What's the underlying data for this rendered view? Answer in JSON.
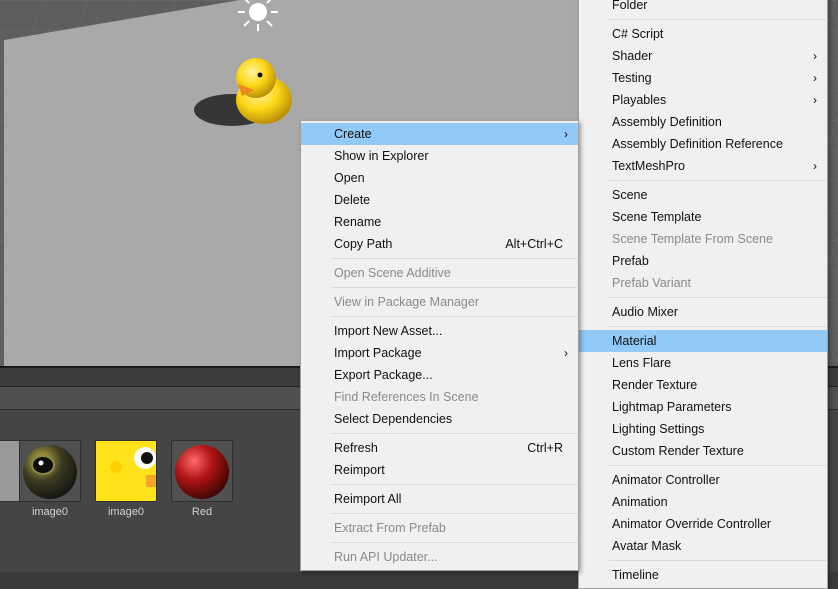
{
  "context_menu": {
    "items": [
      {
        "label": "Create",
        "shortcut": "",
        "submenu": true,
        "disabled": false,
        "highlighted": true
      },
      {
        "label": "Show in Explorer",
        "shortcut": "",
        "submenu": false,
        "disabled": false
      },
      {
        "label": "Open",
        "shortcut": "",
        "submenu": false,
        "disabled": false
      },
      {
        "label": "Delete",
        "shortcut": "",
        "submenu": false,
        "disabled": false
      },
      {
        "label": "Rename",
        "shortcut": "",
        "submenu": false,
        "disabled": false
      },
      {
        "label": "Copy Path",
        "shortcut": "Alt+Ctrl+C",
        "submenu": false,
        "disabled": false
      },
      {
        "sep": true
      },
      {
        "label": "Open Scene Additive",
        "shortcut": "",
        "submenu": false,
        "disabled": true
      },
      {
        "sep": true
      },
      {
        "label": "View in Package Manager",
        "shortcut": "",
        "submenu": false,
        "disabled": true
      },
      {
        "sep": true
      },
      {
        "label": "Import New Asset...",
        "shortcut": "",
        "submenu": false,
        "disabled": false
      },
      {
        "label": "Import Package",
        "shortcut": "",
        "submenu": true,
        "disabled": false
      },
      {
        "label": "Export Package...",
        "shortcut": "",
        "submenu": false,
        "disabled": false
      },
      {
        "label": "Find References In Scene",
        "shortcut": "",
        "submenu": false,
        "disabled": true
      },
      {
        "label": "Select Dependencies",
        "shortcut": "",
        "submenu": false,
        "disabled": false
      },
      {
        "sep": true
      },
      {
        "label": "Refresh",
        "shortcut": "Ctrl+R",
        "submenu": false,
        "disabled": false
      },
      {
        "label": "Reimport",
        "shortcut": "",
        "submenu": false,
        "disabled": false
      },
      {
        "sep": true
      },
      {
        "label": "Reimport All",
        "shortcut": "",
        "submenu": false,
        "disabled": false
      },
      {
        "sep": true
      },
      {
        "label": "Extract From Prefab",
        "shortcut": "",
        "submenu": false,
        "disabled": true
      },
      {
        "sep": true
      },
      {
        "label": "Run API Updater...",
        "shortcut": "",
        "submenu": false,
        "disabled": true
      }
    ]
  },
  "create_submenu": {
    "items": [
      {
        "label": "Folder",
        "submenu": false,
        "disabled": false
      },
      {
        "sep": true
      },
      {
        "label": "C# Script",
        "submenu": false,
        "disabled": false
      },
      {
        "label": "Shader",
        "submenu": true,
        "disabled": false
      },
      {
        "label": "Testing",
        "submenu": true,
        "disabled": false
      },
      {
        "label": "Playables",
        "submenu": true,
        "disabled": false
      },
      {
        "label": "Assembly Definition",
        "submenu": false,
        "disabled": false
      },
      {
        "label": "Assembly Definition Reference",
        "submenu": false,
        "disabled": false
      },
      {
        "label": "TextMeshPro",
        "submenu": true,
        "disabled": false
      },
      {
        "sep": true
      },
      {
        "label": "Scene",
        "submenu": false,
        "disabled": false
      },
      {
        "label": "Scene Template",
        "submenu": false,
        "disabled": false
      },
      {
        "label": "Scene Template From Scene",
        "submenu": false,
        "disabled": true
      },
      {
        "label": "Prefab",
        "submenu": false,
        "disabled": false
      },
      {
        "label": "Prefab Variant",
        "submenu": false,
        "disabled": true
      },
      {
        "sep": true
      },
      {
        "label": "Audio Mixer",
        "submenu": false,
        "disabled": false
      },
      {
        "sep": true
      },
      {
        "label": "Material",
        "submenu": false,
        "disabled": false,
        "highlighted": true
      },
      {
        "label": "Lens Flare",
        "submenu": false,
        "disabled": false
      },
      {
        "label": "Render Texture",
        "submenu": false,
        "disabled": false
      },
      {
        "label": "Lightmap Parameters",
        "submenu": false,
        "disabled": false
      },
      {
        "label": "Lighting Settings",
        "submenu": false,
        "disabled": false
      },
      {
        "label": "Custom Render Texture",
        "submenu": false,
        "disabled": false
      },
      {
        "sep": true
      },
      {
        "label": "Animator Controller",
        "submenu": false,
        "disabled": false
      },
      {
        "label": "Animation",
        "submenu": false,
        "disabled": false
      },
      {
        "label": "Animator Override Controller",
        "submenu": false,
        "disabled": false
      },
      {
        "label": "Avatar Mask",
        "submenu": false,
        "disabled": false
      },
      {
        "sep": true
      },
      {
        "label": "Timeline",
        "submenu": false,
        "disabled": false
      }
    ]
  },
  "assets": [
    {
      "label": "image0",
      "kind": "material-sphere",
      "color": "#3b3a22"
    },
    {
      "label": "image0",
      "kind": "texture",
      "color": "#ffe21a"
    },
    {
      "label": "Red",
      "kind": "material-sphere",
      "color": "#b21414"
    }
  ],
  "colors": {
    "highlight": "#91c9f7",
    "menu_bg": "#f0f0f0",
    "disabled_text": "#8a8a8a",
    "scene_plane": "#a9a9a9",
    "duck_yellow": "#ffd818"
  }
}
